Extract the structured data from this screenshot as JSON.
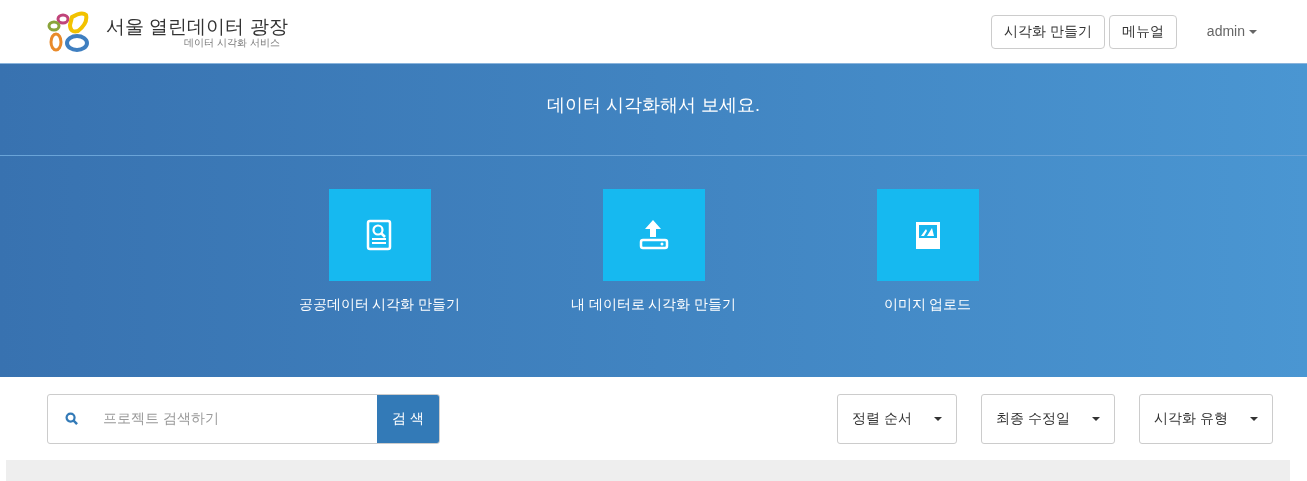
{
  "header": {
    "brand": "서울 열린데이터 광장",
    "subtitle": "데이터 시각화 서비스",
    "buttons": [
      "시각화 만들기",
      "메뉴얼"
    ],
    "user": "admin"
  },
  "banner": {
    "title": "데이터 시각화해서 보세요.",
    "actions": [
      {
        "kind": "search-doc",
        "label": "공공데이터 시각화 만들기"
      },
      {
        "kind": "upload",
        "label": "내 데이터로 시각화 만들기"
      },
      {
        "kind": "image",
        "label": "이미지 업로드"
      }
    ]
  },
  "search": {
    "placeholder": "프로젝트 검색하기",
    "button": "검 색"
  },
  "dropdowns": [
    "정렬 순서",
    "최종 수정일",
    "시각화 유형"
  ]
}
